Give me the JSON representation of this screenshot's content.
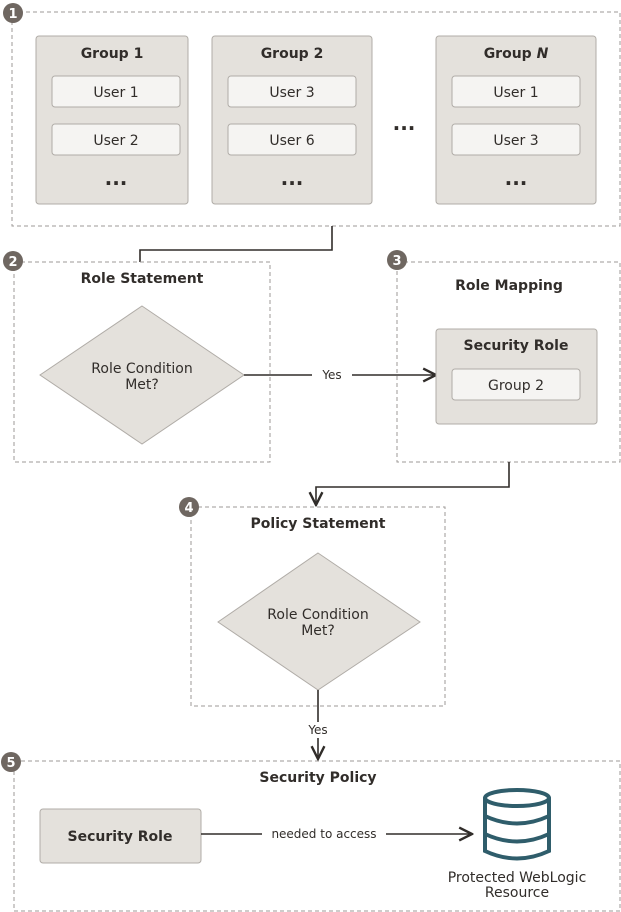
{
  "colors": {
    "group_fill": "#e4e1dc",
    "badge": "#6f6761",
    "database": "#2f5d6b",
    "text": "#312d2a"
  },
  "step1": {
    "badge": "1",
    "groups": [
      {
        "title": "Group 1",
        "users": [
          "User 1",
          "User 2"
        ],
        "more": "..."
      },
      {
        "title": "Group 2",
        "users": [
          "User 3",
          "User 6"
        ],
        "more": "..."
      },
      {
        "title_prefix": "Group ",
        "title_italic": "N",
        "users": [
          "User 1",
          "User 3"
        ],
        "more": "..."
      }
    ],
    "between": "..."
  },
  "step2": {
    "badge": "2",
    "title": "Role Statement",
    "diamond_line1": "Role Condition",
    "diamond_line2": "Met?",
    "yes": "Yes"
  },
  "step3": {
    "badge": "3",
    "title": "Role Mapping",
    "role": "Security Role",
    "group": "Group 2"
  },
  "step4": {
    "badge": "4",
    "title": "Policy Statement",
    "diamond_line1": "Role Condition",
    "diamond_line2": "Met?",
    "yes": "Yes"
  },
  "step5": {
    "badge": "5",
    "title": "Security Policy",
    "role": "Security Role",
    "edge": "needed to access",
    "resource_line1": "Protected WebLogic",
    "resource_line2": "Resource",
    "icon": "database-icon"
  }
}
